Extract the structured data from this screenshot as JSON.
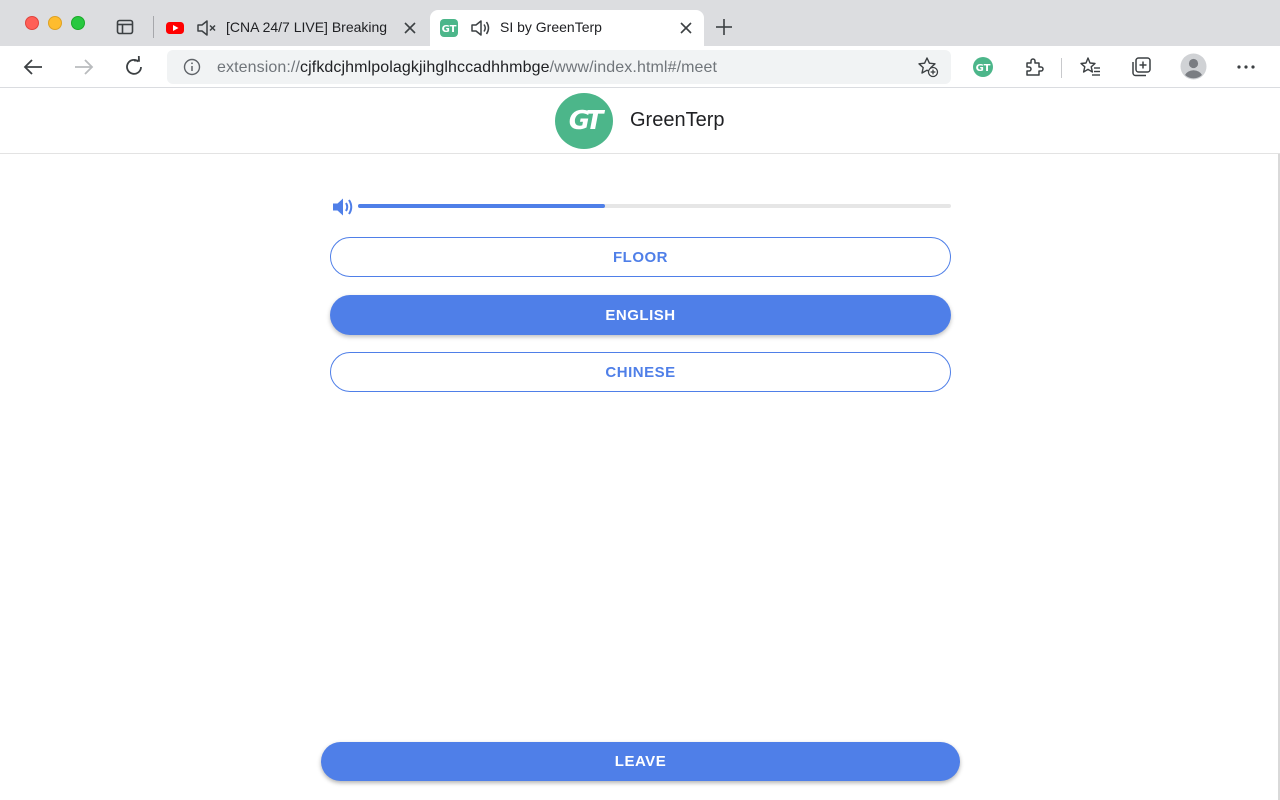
{
  "browser": {
    "tabs": [
      {
        "title": "[CNA 24/7 LIVE] Breaking",
        "favicon": "youtube-icon",
        "audio": "muted-speaker-icon",
        "active": false
      },
      {
        "title": "SI by GreenTerp",
        "favicon": "greenterp-icon",
        "audio": "speaker-icon",
        "active": true
      }
    ],
    "address": {
      "scheme": "extension://",
      "host": "cjfkdcjhmlpolagkjihglhccadhhmbge",
      "path": "/www/index.html#/meet"
    },
    "icons": [
      "back-icon",
      "forward-icon",
      "reload-icon",
      "info-icon",
      "favorite-add-icon",
      "greenterp-extension-icon",
      "extensions-icon",
      "favorites-icon",
      "collections-icon",
      "profile-icon",
      "more-icon"
    ]
  },
  "app": {
    "logo_text": "GT",
    "brand": "GreenTerp",
    "volume_level": 0.416,
    "channels": [
      {
        "label": "FLOOR",
        "selected": false
      },
      {
        "label": "ENGLISH",
        "selected": true
      },
      {
        "label": "CHINESE",
        "selected": false
      }
    ],
    "leave_label": "LEAVE"
  },
  "colors": {
    "accent": "#4f7fe8",
    "brand_green": "#4cb68a",
    "tabstrip": "#dcdde0"
  }
}
